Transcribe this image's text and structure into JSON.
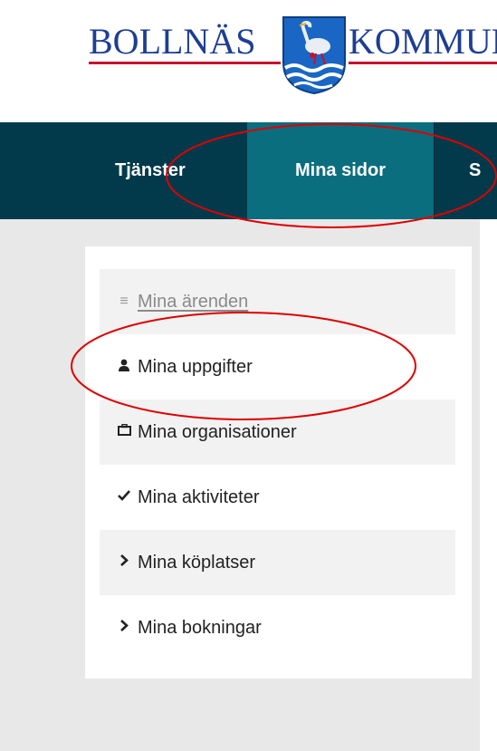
{
  "header": {
    "logo_left": "BOLLNÄS",
    "logo_right": "KOMMUN",
    "crest_icon": "bollnas-coat-of-arms-icon",
    "brand_blue": "#1d3e93",
    "brand_red": "#c8102e"
  },
  "nav": {
    "items": [
      {
        "label": "Tjänster",
        "active": false
      },
      {
        "label": "Mina sidor",
        "active": true
      },
      {
        "label": "S",
        "active": false
      }
    ],
    "bg_color": "#033a4b",
    "active_color": "#0a6e7f"
  },
  "sidebar": {
    "items": [
      {
        "label": "Mina ärenden",
        "icon": "folder-stack-icon",
        "state": "disabled"
      },
      {
        "label": "Mina uppgifter",
        "icon": "user-icon",
        "state": "normal"
      },
      {
        "label": "Mina organisationer",
        "icon": "briefcase-icon",
        "state": "normal"
      },
      {
        "label": "Mina aktiviteter",
        "icon": "checkmark-icon",
        "state": "normal"
      },
      {
        "label": "Mina köplatser",
        "icon": "chevron-right-icon",
        "state": "normal"
      },
      {
        "label": "Mina bokningar",
        "icon": "chevron-right-icon",
        "state": "normal"
      }
    ]
  },
  "annotations": {
    "highlight_color": "#e00000",
    "highlighted": [
      "nav.items.1",
      "sidebar.items.1"
    ]
  }
}
